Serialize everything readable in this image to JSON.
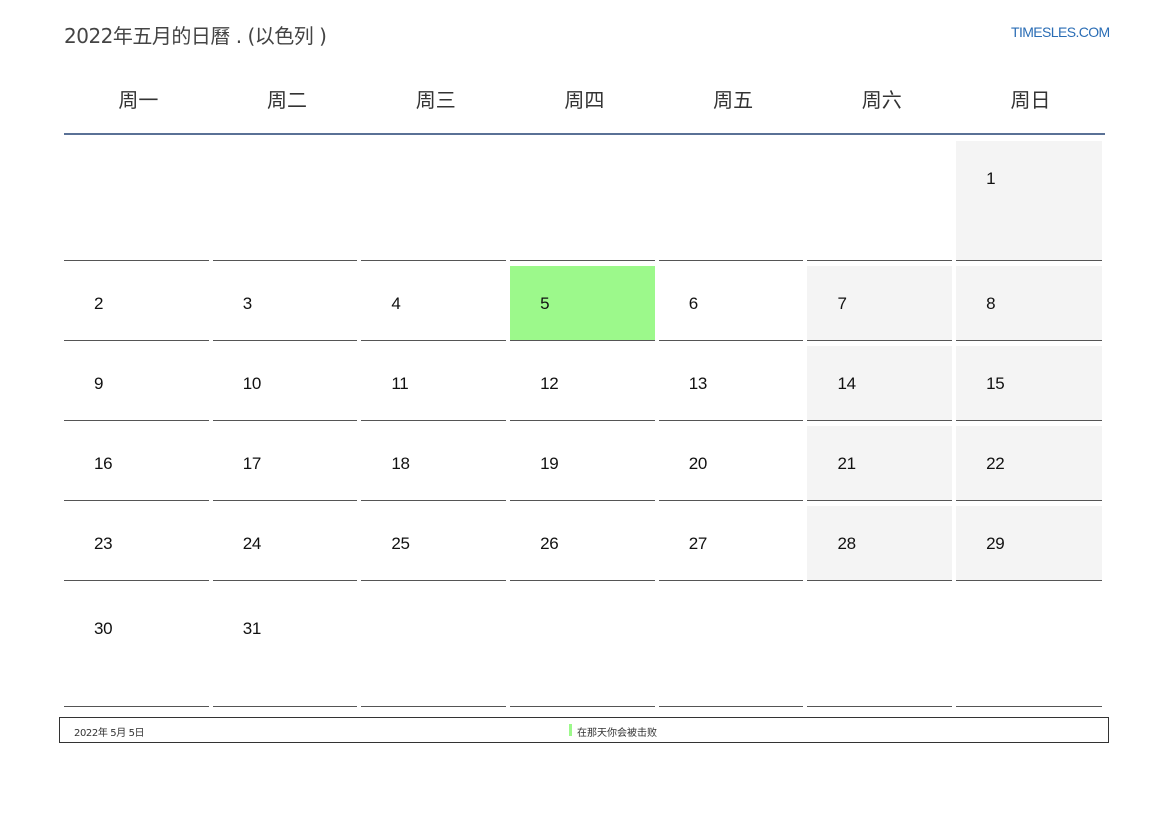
{
  "header": {
    "title": "2022年五月的日曆 . (以色列 )",
    "site": "TIMESLES.COM"
  },
  "weekdays": [
    "周一",
    "周二",
    "周三",
    "周四",
    "周五",
    "周六",
    "周日"
  ],
  "weeks": [
    [
      "",
      "",
      "",
      "",
      "",
      "",
      "1"
    ],
    [
      "2",
      "3",
      "4",
      "5",
      "6",
      "7",
      "8"
    ],
    [
      "9",
      "10",
      "11",
      "12",
      "13",
      "14",
      "15"
    ],
    [
      "16",
      "17",
      "18",
      "19",
      "20",
      "21",
      "22"
    ],
    [
      "23",
      "24",
      "25",
      "26",
      "27",
      "28",
      "29"
    ],
    [
      "30",
      "31",
      "",
      "",
      "",
      "",
      ""
    ]
  ],
  "highlight": {
    "day": "5",
    "color": "#9cf98b"
  },
  "colors": {
    "weekend_bg": "#f4f4f4",
    "header_rule": "#5a7196",
    "link": "#2a6db5"
  },
  "legend": {
    "date": "2022年 5月 5日",
    "note": "在那天你会被击败"
  }
}
